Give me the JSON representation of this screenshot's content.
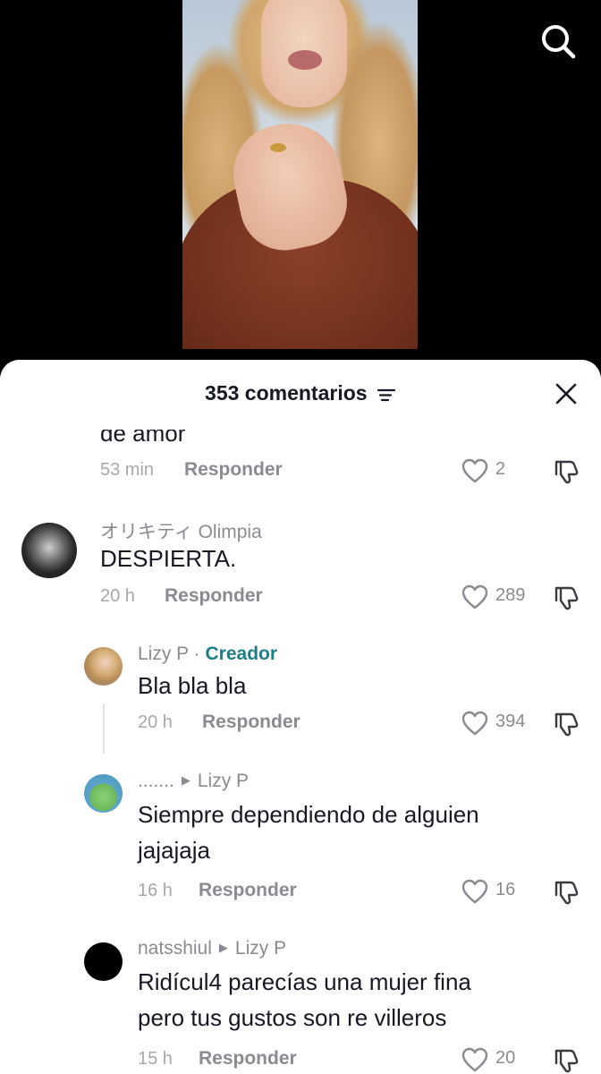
{
  "video": {},
  "header": {
    "count_label": "353 comentarios"
  },
  "comments": {
    "top": {
      "text_partial": "de amor",
      "time": "53 min",
      "reply": "Responder",
      "likes": "2"
    },
    "c1": {
      "author": "オリキティ Olimpia",
      "text": "DESPIERTA.",
      "time": "20 h",
      "reply": "Responder",
      "likes": "289"
    },
    "c2": {
      "author": "Lizy P",
      "dot": "·",
      "badge": "Creador",
      "text": "Bla bla bla",
      "time": "20 h",
      "reply": "Responder",
      "likes": "394"
    },
    "c3": {
      "author": ".......",
      "reply_to": "Lizy P",
      "text_line1": "Siempre dependiendo de alguien",
      "text_line2": "jajajaja",
      "time": "16 h",
      "reply": "Responder",
      "likes": "16"
    },
    "c4": {
      "author": "natsshiul",
      "reply_to": "Lizy P",
      "text_line1": "Ridícul4 parecías una mujer fina",
      "text_line2": "pero tus gustos son re villeros",
      "time": "15 h",
      "reply": "Responder",
      "likes": "20"
    }
  },
  "icons": {
    "search": "search-icon",
    "close": "close-icon",
    "sort": "sort-icon",
    "like": "heart-outline-icon",
    "dislike": "thumbs-down-icon",
    "reply_arrow": "caret-right-icon"
  },
  "colors": {
    "creator_badge": "#1d7f86",
    "meta_text": "#8a8b91",
    "text": "#161823"
  }
}
